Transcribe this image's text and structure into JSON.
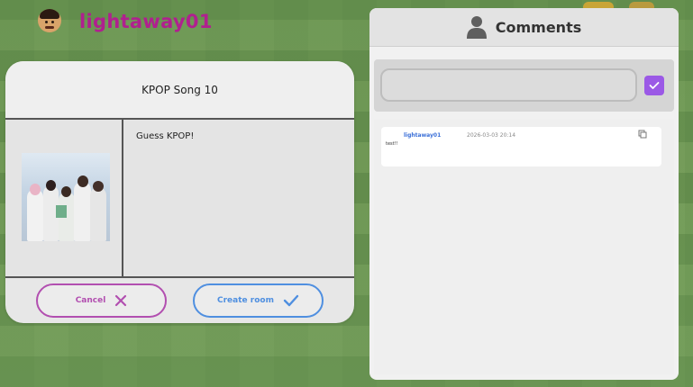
{
  "header": {
    "username": "lightaway01"
  },
  "dialog": {
    "title": "KPOP Song 10",
    "description": "Guess KPOP!",
    "cancel_label": "Cancel",
    "create_label": "Create room"
  },
  "comments": {
    "title": "Comments",
    "input_value": "",
    "items": [
      {
        "user": "lightaway01",
        "timestamp": "2026-03-03 20:14",
        "text": "test!!"
      }
    ]
  },
  "colors": {
    "username": "#b0208f",
    "cancel": "#b24fb0",
    "create": "#4f8fe0",
    "send": "#9b59e6"
  }
}
